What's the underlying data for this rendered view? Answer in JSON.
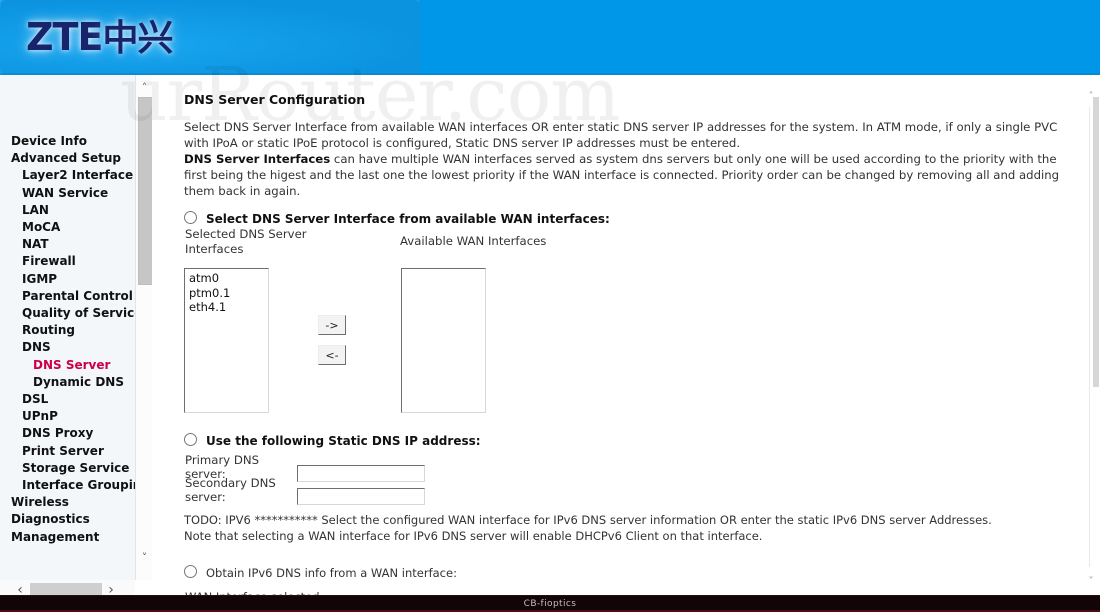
{
  "brand": {
    "logo_text": "ZTE",
    "logo_cn": "中兴"
  },
  "watermark": {
    "text": "urRouter.com"
  },
  "sidebar": {
    "items": [
      {
        "label": "Device Info",
        "level": 0,
        "active": false
      },
      {
        "label": "Advanced Setup",
        "level": 0,
        "active": false
      },
      {
        "label": "Layer2 Interface",
        "level": 1,
        "active": false
      },
      {
        "label": "WAN Service",
        "level": 1,
        "active": false
      },
      {
        "label": "LAN",
        "level": 1,
        "active": false
      },
      {
        "label": "MoCA",
        "level": 1,
        "active": false
      },
      {
        "label": "NAT",
        "level": 1,
        "active": false
      },
      {
        "label": "Firewall",
        "level": 1,
        "active": false
      },
      {
        "label": "IGMP",
        "level": 1,
        "active": false
      },
      {
        "label": "Parental Control",
        "level": 1,
        "active": false
      },
      {
        "label": "Quality of Service",
        "level": 1,
        "active": false
      },
      {
        "label": "Routing",
        "level": 1,
        "active": false
      },
      {
        "label": "DNS",
        "level": 1,
        "active": false
      },
      {
        "label": "DNS Server",
        "level": 2,
        "active": true
      },
      {
        "label": "Dynamic DNS",
        "level": 2,
        "active": false
      },
      {
        "label": "DSL",
        "level": 1,
        "active": false
      },
      {
        "label": "UPnP",
        "level": 1,
        "active": false
      },
      {
        "label": "DNS Proxy",
        "level": 1,
        "active": false
      },
      {
        "label": "Print Server",
        "level": 1,
        "active": false
      },
      {
        "label": "Storage Service",
        "level": 1,
        "active": false
      },
      {
        "label": "Interface Grouping",
        "level": 1,
        "active": false
      },
      {
        "label": "Wireless",
        "level": 0,
        "active": false
      },
      {
        "label": "Diagnostics",
        "level": 0,
        "active": false
      },
      {
        "label": "Management",
        "level": 0,
        "active": false
      }
    ],
    "scroll": {
      "up_arrow": "˄",
      "down_arrow": "˅",
      "left_arrow": "‹",
      "right_arrow": "›"
    }
  },
  "page": {
    "title": "DNS Server Configuration",
    "intro_line1": "Select DNS Server Interface from available WAN interfaces OR enter static DNS server IP addresses for the system. In ATM mode, if only a single PVC with IPoA or static IPoE protocol is configured, Static DNS server IP addresses must be entered.",
    "intro_bold": "DNS Server Interfaces",
    "intro_line2": " can have multiple WAN interfaces served as system dns servers but only one will be used according to the priority with the first being the higest and the last one the lowest priority if the WAN interface is connected. Priority order can be changed by removing all and adding them back in again."
  },
  "select_section": {
    "radio_label": "Select DNS Server Interface from available WAN interfaces:",
    "selected_list_label": "Selected DNS Server Interfaces",
    "available_list_label": "Available WAN Interfaces",
    "selected_items": [
      "atm0",
      "ptm0.1",
      "eth4.1"
    ],
    "available_items": [],
    "move_right_label": "->",
    "move_left_label": "<-"
  },
  "static_section": {
    "radio_label": "Use the following Static DNS IP address:",
    "primary_label": "Primary DNS server:",
    "primary_value": "",
    "secondary_label": "Secondary DNS server:",
    "secondary_value": ""
  },
  "ipv6_section": {
    "todo_line1": "TODO: IPV6 *********** Select the configured WAN interface for IPv6 DNS server information OR enter the static IPv6 DNS server Addresses.",
    "todo_line2": "Note that selecting a WAN interface for IPv6 DNS server will enable DHCPv6 Client on that interface.",
    "radio_label": "Obtain IPv6 DNS info from a WAN interface:",
    "wan_if_label": "WAN Interface selected:",
    "wan_if_value": "",
    "dropdown_arrow": "⌄"
  },
  "footer": {
    "text": "CB-fioptics"
  },
  "colors": {
    "banner_blue": "#0097e8",
    "active_menu": "#cc0044",
    "logo_navy": "#17246b",
    "footer_bg": "#120507"
  }
}
